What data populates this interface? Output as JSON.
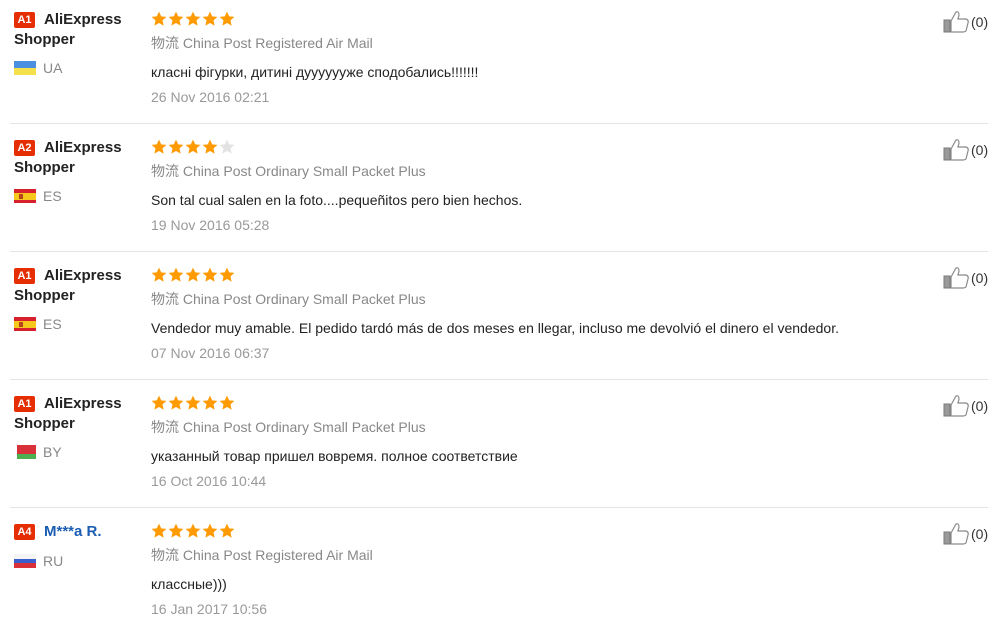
{
  "colors": {
    "star_filled": "#ff9a00",
    "star_empty": "#e3e3e3",
    "badge": "#e62e04",
    "link": "#1a5db2",
    "divider": "#e4e4e4"
  },
  "reviews": [
    {
      "level": "A1",
      "username_line1": "AliExpress",
      "username_line2": "Shopper",
      "country": "UA",
      "country_flag": "ukraine-flag-icon",
      "stars": 5,
      "logistics": "物流 China Post Registered Air Mail",
      "text": "класні фігурки, дитині дууууууже сподобались!!!!!!!",
      "date": "26 Nov 2016 02:21",
      "helpful_count": "(0)"
    },
    {
      "level": "A2",
      "username_line1": "AliExpress",
      "username_line2": "Shopper",
      "country": "ES",
      "country_flag": "spain-flag-icon",
      "stars": 4,
      "logistics": "物流 China Post Ordinary Small Packet Plus",
      "text": "Son tal cual salen en la foto....pequeñitos pero bien hechos.",
      "date": "19 Nov 2016 05:28",
      "helpful_count": "(0)"
    },
    {
      "level": "A1",
      "username_line1": "AliExpress",
      "username_line2": "Shopper",
      "country": "ES",
      "country_flag": "spain-flag-icon",
      "stars": 5,
      "logistics": "物流 China Post Ordinary Small Packet Plus",
      "text": "Vendedor muy amable. El pedido tardó más de dos meses en llegar, incluso me devolvió el dinero el vendedor.",
      "date": "07 Nov 2016 06:37",
      "helpful_count": "(0)"
    },
    {
      "level": "A1",
      "username_line1": "AliExpress",
      "username_line2": "Shopper",
      "country": "BY",
      "country_flag": "belarus-flag-icon",
      "stars": 5,
      "logistics": "物流 China Post Ordinary Small Packet Plus",
      "text": "указанный товар пришел вовремя. полное соответствие",
      "date": "16 Oct 2016 10:44",
      "helpful_count": "(0)"
    },
    {
      "level": "A4",
      "username_line1": "M***a R.",
      "username_line2": "",
      "country": "RU",
      "country_flag": "russia-flag-icon",
      "stars": 5,
      "logistics": "物流 China Post Registered Air Mail",
      "text": "классные)))",
      "date": "16 Jan 2017 10:56",
      "helpful_count": "(0)"
    }
  ]
}
